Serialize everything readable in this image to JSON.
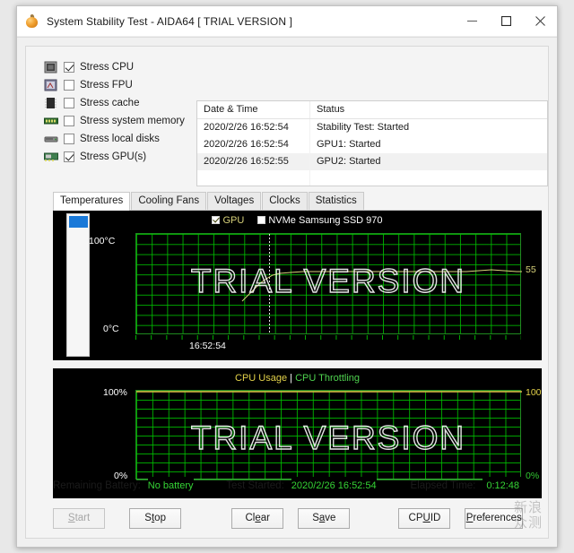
{
  "window": {
    "title": "System Stability Test - AIDA64  [ TRIAL VERSION ]",
    "icon": "flame-icon",
    "minimize_label": "–",
    "maximize_label": "□",
    "close_label": "✕"
  },
  "stress_options": [
    {
      "label": "Stress CPU",
      "checked": true,
      "icon": "cpu-icon"
    },
    {
      "label": "Stress FPU",
      "checked": false,
      "icon": "fpu-icon"
    },
    {
      "label": "Stress cache",
      "checked": false,
      "icon": "cache-icon"
    },
    {
      "label": "Stress system memory",
      "checked": false,
      "icon": "memory-icon"
    },
    {
      "label": "Stress local disks",
      "checked": false,
      "icon": "disk-icon"
    },
    {
      "label": "Stress GPU(s)",
      "checked": true,
      "icon": "gpu-icon"
    }
  ],
  "log": {
    "columns": [
      "Date & Time",
      "Status"
    ],
    "rows": [
      {
        "time": "2020/2/26 16:52:54",
        "status": "Stability Test: Started",
        "selected": false
      },
      {
        "time": "2020/2/26 16:52:54",
        "status": "GPU1: Started",
        "selected": false
      },
      {
        "time": "2020/2/26 16:52:55",
        "status": "GPU2: Started",
        "selected": true
      }
    ]
  },
  "tabs": [
    {
      "label": "Temperatures",
      "active": true
    },
    {
      "label": "Cooling Fans",
      "active": false
    },
    {
      "label": "Voltages",
      "active": false
    },
    {
      "label": "Clocks",
      "active": false
    },
    {
      "label": "Statistics",
      "active": false
    }
  ],
  "temperature_chart": {
    "legend": [
      {
        "label": "GPU",
        "checked": true,
        "color": "#d8d27a"
      },
      {
        "label": "NVMe Samsung SSD 970",
        "checked": false,
        "color": "#ffffff"
      }
    ],
    "y_top": "100°C",
    "y_bottom": "0°C",
    "x_label": "16:52:54",
    "current_value": "55",
    "watermark": "TRIAL VERSION"
  },
  "cpu_chart": {
    "legend_usage": "CPU Usage",
    "legend_separator": "|",
    "legend_throttling": "CPU Throttling",
    "y_top_left": "100%",
    "y_bottom_left": "0%",
    "y_top_right": "100%",
    "y_bottom_right": "0%",
    "watermark": "TRIAL VERSION"
  },
  "chart_data": [
    {
      "type": "line",
      "title": "Temperatures",
      "xlabel": "16:52:54",
      "ylabel": "°C",
      "ylim": [
        0,
        100
      ],
      "grid": true,
      "legend_position": "top",
      "annotations": [
        "55",
        "TRIAL VERSION"
      ],
      "series": [
        {
          "name": "GPU",
          "color": "#d8d27a",
          "visible": true,
          "unit": "°C",
          "current": 55,
          "x": [
            0,
            5,
            10,
            15,
            20,
            25,
            30,
            35,
            40,
            45,
            50,
            55,
            60,
            65,
            70,
            75,
            80,
            85,
            90,
            95,
            100
          ],
          "values": [
            33,
            36,
            41,
            47,
            52,
            55,
            55,
            55,
            55,
            55,
            56,
            55,
            55,
            55,
            55,
            55,
            55,
            55,
            55,
            56,
            55
          ]
        },
        {
          "name": "NVMe Samsung SSD 970",
          "color": "#ffffff",
          "visible": false,
          "unit": "°C",
          "current": null,
          "x": [],
          "values": []
        }
      ]
    },
    {
      "type": "line",
      "title": "CPU Usage | CPU Throttling",
      "xlabel": "",
      "ylabel": "%",
      "ylim": [
        0,
        100
      ],
      "grid": true,
      "legend_position": "top",
      "annotations": [
        "TRIAL VERSION"
      ],
      "series": [
        {
          "name": "CPU Usage",
          "color": "#e3d24a",
          "visible": true,
          "unit": "%",
          "current": 100,
          "x": [
            0,
            10,
            20,
            30,
            40,
            50,
            60,
            70,
            80,
            90,
            100
          ],
          "values": [
            100,
            100,
            100,
            100,
            100,
            100,
            100,
            100,
            100,
            100,
            100
          ]
        },
        {
          "name": "CPU Throttling",
          "color": "#4fd34f",
          "visible": true,
          "unit": "%",
          "current": 0,
          "x": [
            0,
            10,
            20,
            30,
            40,
            50,
            60,
            70,
            80,
            90,
            100
          ],
          "values": [
            0,
            0,
            0,
            0,
            0,
            0,
            0,
            0,
            0,
            0,
            0
          ]
        }
      ]
    }
  ],
  "status": {
    "battery_label": "Remaining Battery:",
    "battery_value": "No battery",
    "started_label": "Test Started:",
    "started_value": "2020/2/26 16:52:54",
    "elapsed_label": "Elapsed Time:",
    "elapsed_value": "0:12:48"
  },
  "buttons": [
    {
      "id": "start",
      "pre": "",
      "accel": "S",
      "post": "tart",
      "disabled": true
    },
    {
      "id": "stop",
      "pre": "S",
      "accel": "t",
      "post": "op",
      "disabled": false
    },
    {
      "id": "clear",
      "pre": "Cl",
      "accel": "e",
      "post": "ar",
      "disabled": false
    },
    {
      "id": "save",
      "pre": "S",
      "accel": "a",
      "post": "ve",
      "disabled": false
    },
    {
      "id": "cpuid",
      "pre": "CP",
      "accel": "U",
      "post": "ID",
      "disabled": false
    },
    {
      "id": "preferences",
      "pre": "",
      "accel": "P",
      "post": "references",
      "disabled": false
    }
  ],
  "corner_watermark": {
    "line1": "新浪",
    "line2": "众测"
  }
}
